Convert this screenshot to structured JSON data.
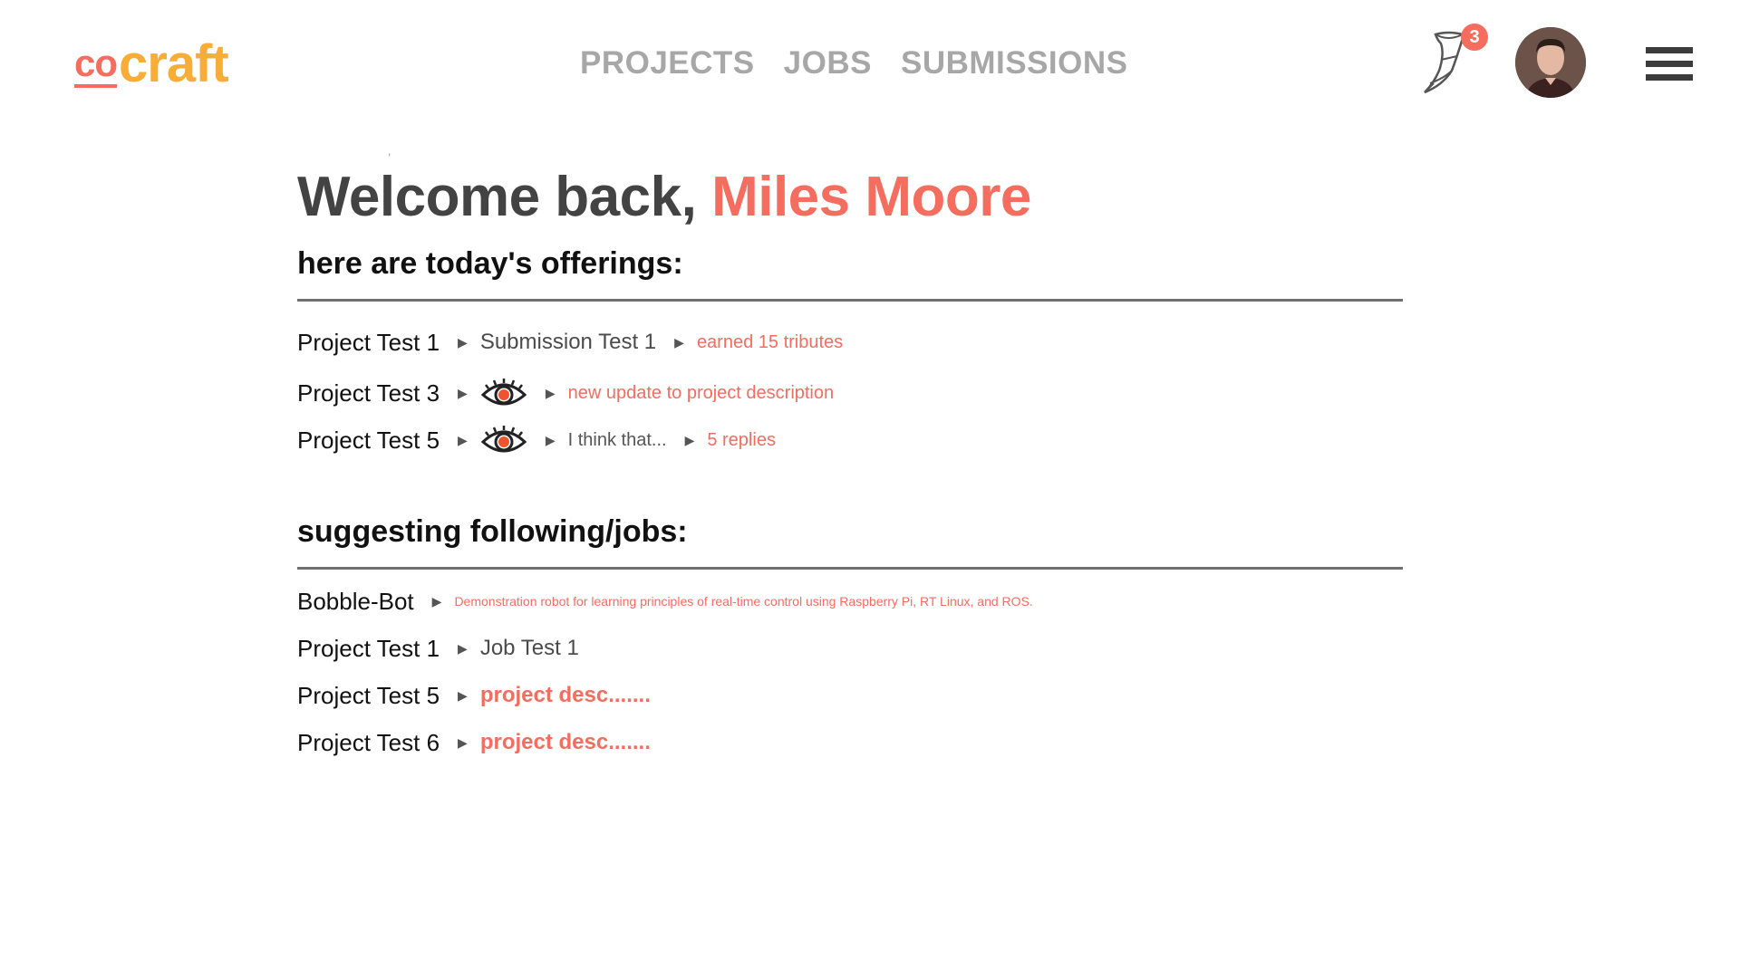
{
  "header": {
    "logo_co": "co",
    "logo_craft": "craft",
    "nav": [
      "PROJECTS",
      "JOBS",
      "SUBMISSIONS"
    ],
    "notification_count": "3"
  },
  "welcome": {
    "greeting": "Welcome back,",
    "name": "Miles Moore"
  },
  "offerings": {
    "heading": "here are today's offerings:",
    "rows": [
      {
        "project": "Project Test 1",
        "item": "Submission Test 1",
        "note": "earned 15 tributes"
      },
      {
        "project": "Project Test 3",
        "icon": "eye-icon",
        "note": "new update to project description"
      },
      {
        "project": "Project Test 5",
        "icon": "eye-icon",
        "comment": "I think that...",
        "note": "5 replies"
      }
    ]
  },
  "suggestions": {
    "heading": "suggesting following/jobs:",
    "rows": [
      {
        "project": "Bobble-Bot",
        "detail": "Demonstration robot for learning principles of real-time control using Raspberry Pi, RT Linux, and ROS."
      },
      {
        "project": "Project Test 1",
        "detail": "Job Test 1"
      },
      {
        "project": "Project Test 5",
        "detail": "project desc......."
      },
      {
        "project": "Project Test 6",
        "detail": "project desc......."
      }
    ]
  },
  "colors": {
    "accent": "#f46d5e",
    "logo_orange": "#f8ad36",
    "nav_gray": "#a7a7a7"
  }
}
